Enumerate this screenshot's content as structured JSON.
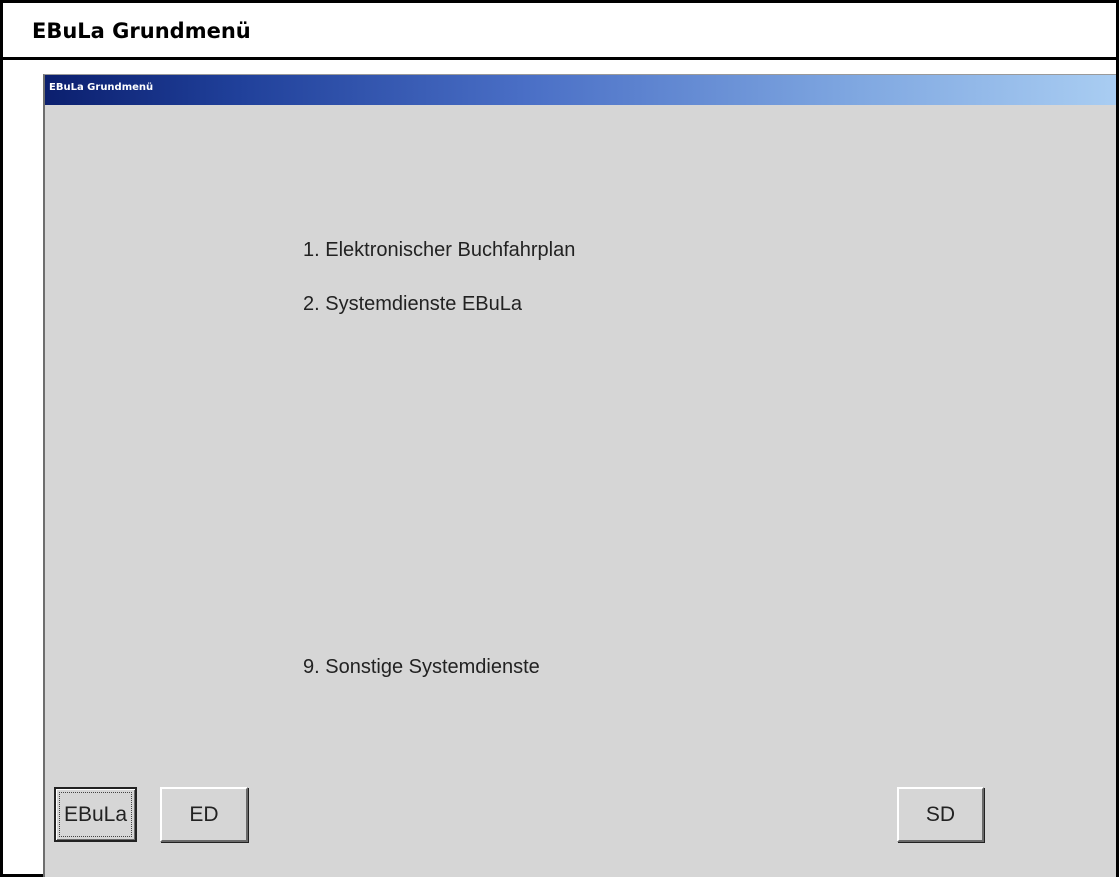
{
  "outer_header": {
    "title": "EBuLa Grundmenü"
  },
  "window": {
    "title": "EBuLa Grundmenü"
  },
  "menu": {
    "items": [
      {
        "label": "1. Elektronischer Buchfahrplan"
      },
      {
        "label": "2. Systemdienste EBuLa"
      },
      {
        "label": "9. Sonstige Systemdienste"
      }
    ]
  },
  "buttons": {
    "ebula": "EBuLa",
    "ed": "ED",
    "sd": "SD"
  },
  "colors": {
    "window_background": "#d6d6d6",
    "titlebar_start": "#0b1f6e",
    "titlebar_end": "#a9cdf2"
  }
}
